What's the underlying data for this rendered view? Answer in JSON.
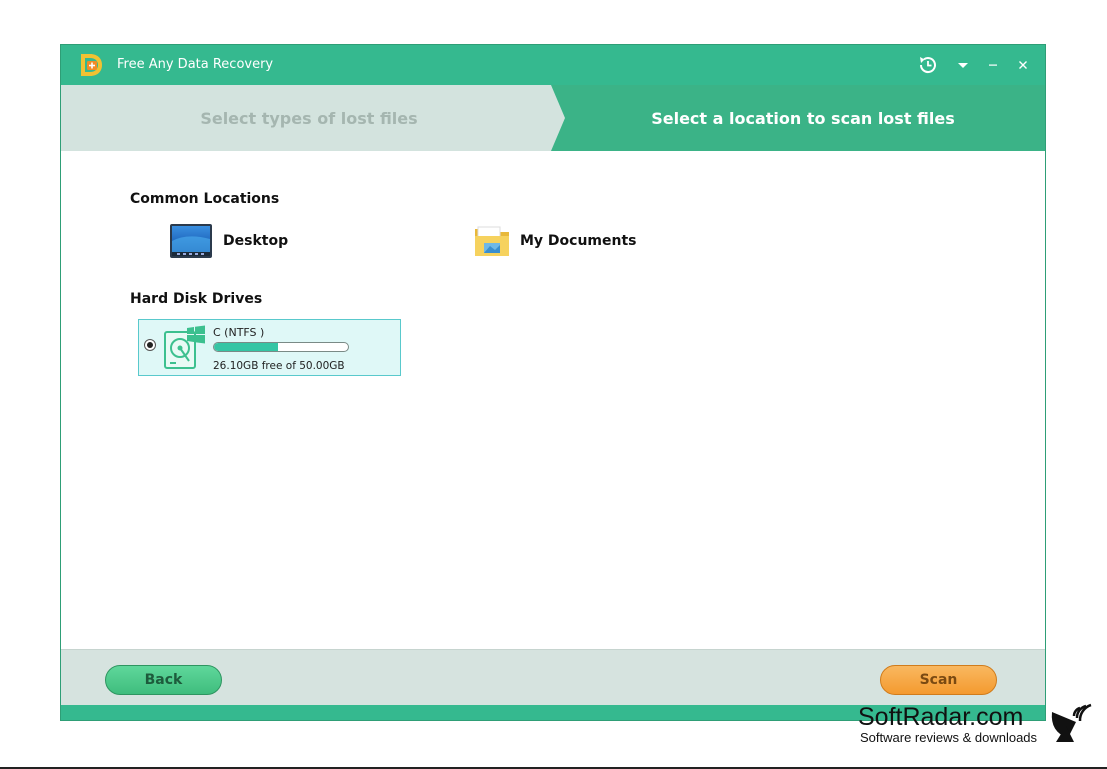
{
  "window": {
    "title": "Free Any Data Recovery",
    "accent_color": "#35b98f"
  },
  "titlebar_buttons": [
    {
      "icon": "history-icon"
    },
    {
      "icon": "dropdown-arrow-icon"
    },
    {
      "icon": "minimize-icon"
    },
    {
      "icon": "close-icon"
    }
  ],
  "steps": {
    "step1": "Select types of lost files",
    "step2": "Select a location to scan lost files",
    "active": 2
  },
  "common_locations": {
    "heading": "Common Locations",
    "items": [
      {
        "label": "Desktop",
        "icon": "desktop-icon"
      },
      {
        "label": "My Documents",
        "icon": "folder-icon"
      }
    ]
  },
  "hard_disks": {
    "heading": "Hard Disk Drives",
    "drives": [
      {
        "name": "C  (NTFS )",
        "free_text": "26.10GB free of 50.00GB",
        "used_fraction": 0.478,
        "selected": true,
        "icon": "hard-drive-windows-icon"
      }
    ]
  },
  "footer": {
    "back_label": "Back",
    "scan_label": "Scan",
    "back_color": "#4fcb8b",
    "scan_color": "#f5a640"
  },
  "watermark": {
    "title": "SoftRadar.com",
    "subtitle": "Software reviews & downloads",
    "icon": "satellite-dish-icon"
  }
}
